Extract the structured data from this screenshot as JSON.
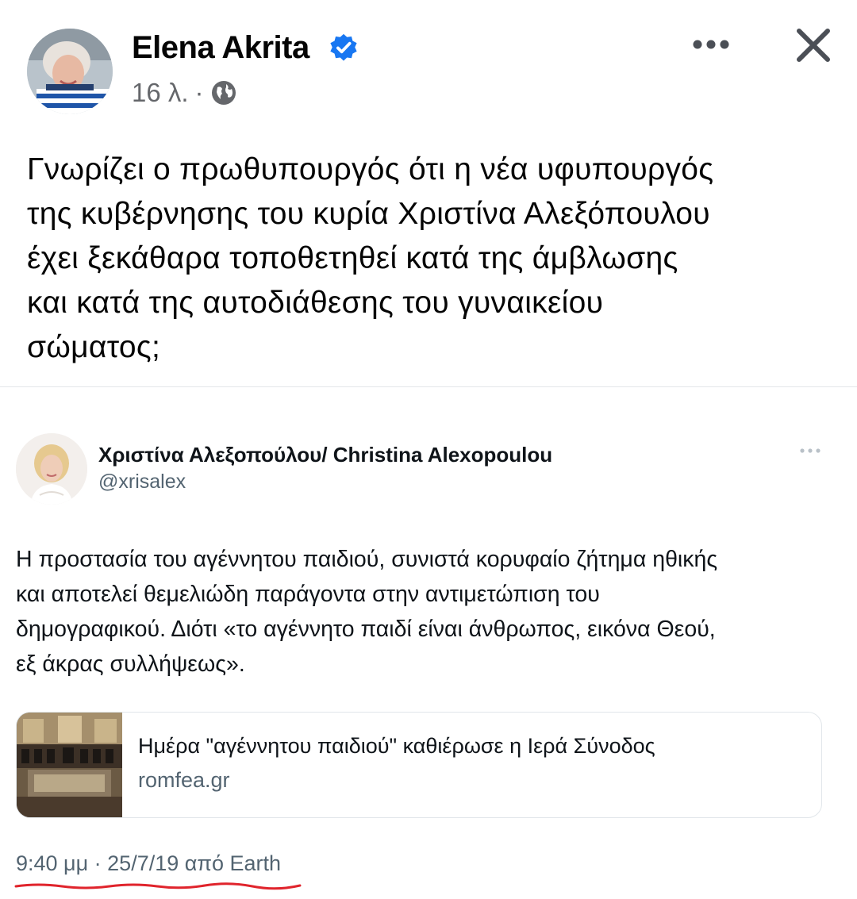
{
  "post": {
    "author_name": "Elena Akrita",
    "time_ago": "16 λ.",
    "separator": "·",
    "text_lines": [
      "Γνωρίζει ο πρωθυπουργός ότι η νέα υφυπουργός",
      "της κυβέρνησης του κυρία Χριστίνα Αλεξόπουλου",
      "έχει ξεκάθαρα τοποθετηθεί κατά της άμβλωσης",
      "και κατά της αυτοδιάθεσης του γυναικείου",
      "σώματος;"
    ]
  },
  "tweet": {
    "display_name": "Χριστίνα Αλεξοπούλου/ Christina Alexopoulou",
    "handle": "@xrisalex",
    "text_lines": [
      "Η προστασία του αγέννητου παιδιού, συνιστά κορυφαίο ζήτημα ηθικής",
      "και αποτελεί θεμελιώδη παράγοντα στην αντιμετώπιση του",
      "δημογραφικού. Διότι «το αγέννητο παιδί είναι άνθρωπος, εικόνα Θεού,",
      "εξ άκρας συλλήψεως»."
    ],
    "link_card": {
      "title": "Ημέρα \"αγέννητου παιδιού\" καθιέρωσε η Ιερά Σύνοδος",
      "domain": "romfea.gr"
    },
    "timestamp": "9:40 μμ · 25/7/19 από Earth"
  },
  "icons": {
    "verified": "verified-badge-icon",
    "audience": "globe-icon",
    "more": "more-horizontal-icon",
    "close": "close-icon"
  },
  "colors": {
    "text_primary": "#050505",
    "text_secondary": "#65676b",
    "verified_blue": "#1877f2",
    "tweet_secondary": "#536471",
    "annotation_red": "#e0242c"
  }
}
